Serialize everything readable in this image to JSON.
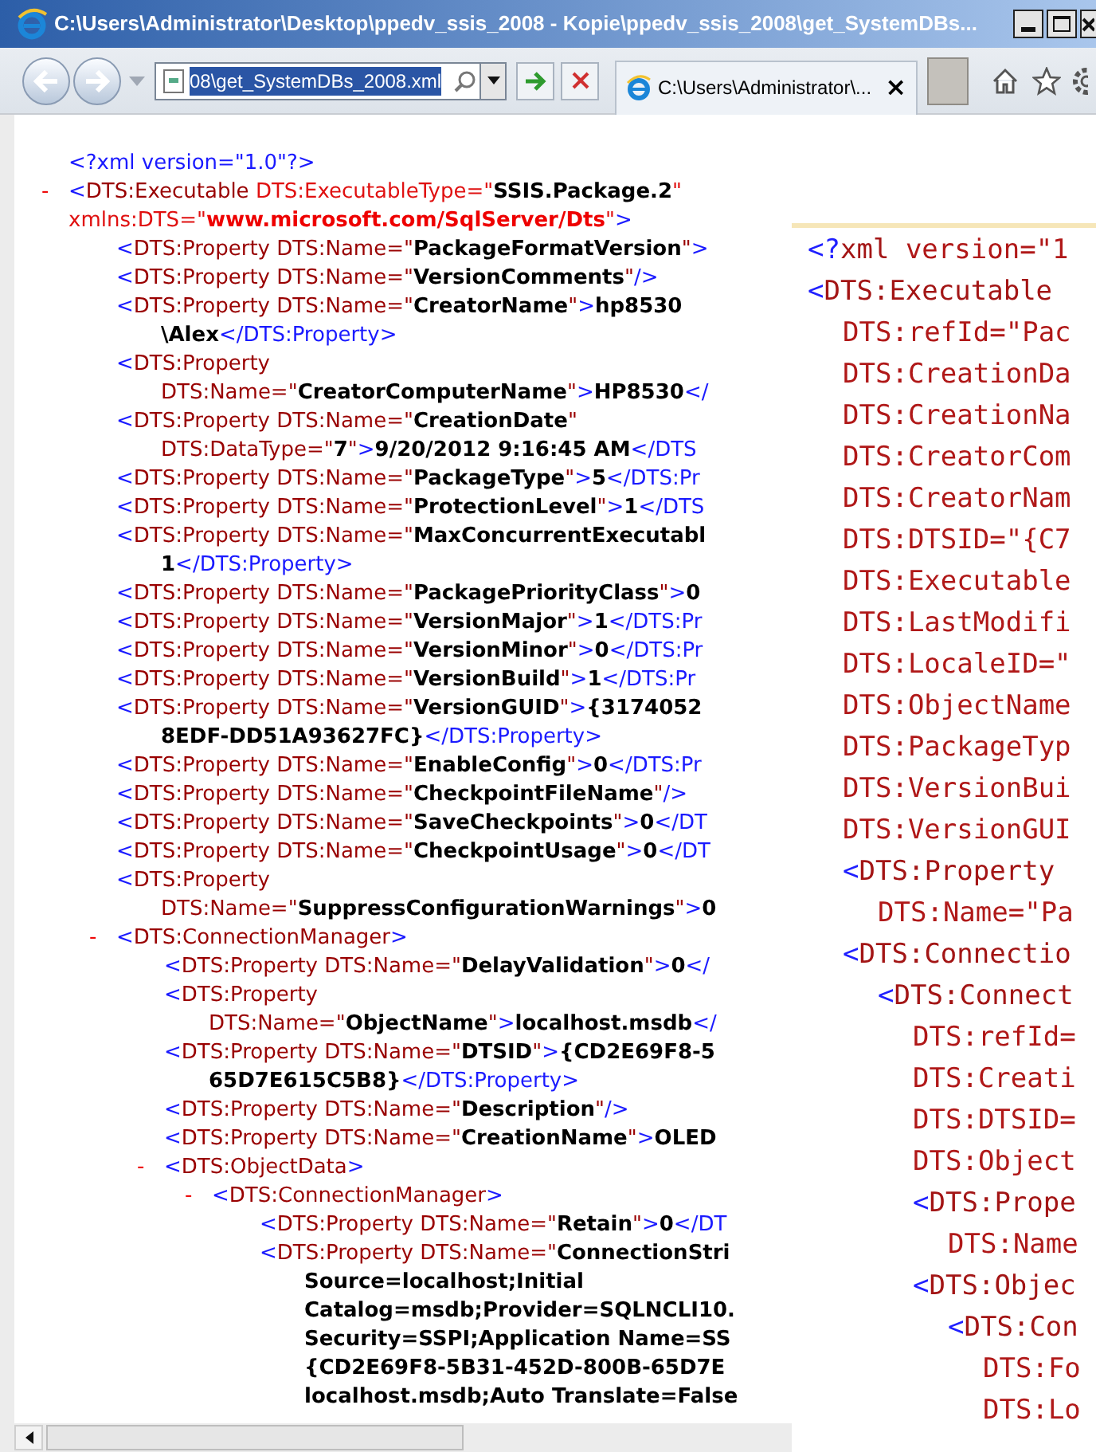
{
  "window": {
    "title": "C:\\Users\\Administrator\\Desktop\\ppedv_ssis_2008 - Kopie\\ppedv_ssis_2008\\get_SystemDBs..."
  },
  "toolbar": {
    "address": {
      "value": "08\\get_SystemDBs_2008.xml",
      "selected": true
    },
    "tab": {
      "title": "C:\\Users\\Administrator\\...",
      "close": "×"
    }
  },
  "xml_view": {
    "nodes": [
      {
        "lines": [
          [
            {
              "kind": "mark",
              "text": "<?xml version=\"1.0\"?>"
            }
          ]
        ]
      },
      {
        "toggle": "-",
        "expanded": true,
        "lines": [
          [
            {
              "kind": "mark",
              "text": "<"
            },
            {
              "kind": "tag",
              "text": "DTS:Executable"
            },
            {
              "kind": "attr",
              "text": " DTS:ExecutableType=\""
            },
            {
              "kind": "val",
              "text": "SSIS.Package.2"
            },
            {
              "kind": "attr",
              "text": "\""
            }
          ],
          [
            {
              "kind": "attr",
              "text": "xmlns:DTS=\""
            },
            {
              "kind": "ns",
              "text": "www.microsoft.com/SqlServer/Dts"
            },
            {
              "kind": "attr",
              "text": "\""
            },
            {
              "kind": "mark",
              "text": ">"
            }
          ]
        ],
        "children": [
          {
            "lines": [
              [
                {
                  "kind": "mark",
                  "text": "<"
                },
                {
                  "kind": "tag",
                  "text": "DTS:Property DTS:Name=\""
                },
                {
                  "kind": "val",
                  "text": "PackageFormatVersion"
                },
                {
                  "kind": "tag",
                  "text": "\""
                },
                {
                  "kind": "mark",
                  "text": ">"
                }
              ]
            ]
          },
          {
            "lines": [
              [
                {
                  "kind": "mark",
                  "text": "<"
                },
                {
                  "kind": "tag",
                  "text": "DTS:Property DTS:Name=\""
                },
                {
                  "kind": "val",
                  "text": "VersionComments"
                },
                {
                  "kind": "tag",
                  "text": "\""
                },
                {
                  "kind": "mark",
                  "text": "/>"
                }
              ]
            ]
          },
          {
            "lines": [
              [
                {
                  "kind": "mark",
                  "text": "<"
                },
                {
                  "kind": "tag",
                  "text": "DTS:Property DTS:Name=\""
                },
                {
                  "kind": "val",
                  "text": "CreatorName"
                },
                {
                  "kind": "tag",
                  "text": "\""
                },
                {
                  "kind": "mark",
                  "text": ">"
                },
                {
                  "kind": "val",
                  "text": "hp8530"
                }
              ],
              [
                {
                  "kind": "val",
                  "text": "\\Alex"
                },
                {
                  "kind": "mark",
                  "text": "</DTS:Property>"
                }
              ]
            ]
          },
          {
            "lines": [
              [
                {
                  "kind": "mark",
                  "text": "<"
                },
                {
                  "kind": "tag",
                  "text": "DTS:Property"
                }
              ],
              [
                {
                  "kind": "tag",
                  "text": "DTS:Name=\""
                },
                {
                  "kind": "val",
                  "text": "CreatorComputerName"
                },
                {
                  "kind": "tag",
                  "text": "\""
                },
                {
                  "kind": "mark",
                  "text": ">"
                },
                {
                  "kind": "val",
                  "text": "HP8530"
                },
                {
                  "kind": "mark",
                  "text": "</"
                }
              ]
            ]
          },
          {
            "lines": [
              [
                {
                  "kind": "mark",
                  "text": "<"
                },
                {
                  "kind": "tag",
                  "text": "DTS:Property DTS:Name=\""
                },
                {
                  "kind": "val",
                  "text": "CreationDate"
                },
                {
                  "kind": "tag",
                  "text": "\""
                }
              ],
              [
                {
                  "kind": "tag",
                  "text": "DTS:DataType=\""
                },
                {
                  "kind": "val",
                  "text": "7"
                },
                {
                  "kind": "tag",
                  "text": "\""
                },
                {
                  "kind": "mark",
                  "text": ">"
                },
                {
                  "kind": "val",
                  "text": "9/20/2012 9:16:45 AM"
                },
                {
                  "kind": "mark",
                  "text": "</DTS"
                }
              ]
            ]
          },
          {
            "lines": [
              [
                {
                  "kind": "mark",
                  "text": "<"
                },
                {
                  "kind": "tag",
                  "text": "DTS:Property DTS:Name=\""
                },
                {
                  "kind": "val",
                  "text": "PackageType"
                },
                {
                  "kind": "tag",
                  "text": "\""
                },
                {
                  "kind": "mark",
                  "text": ">"
                },
                {
                  "kind": "val",
                  "text": "5"
                },
                {
                  "kind": "mark",
                  "text": "</DTS:Pr"
                }
              ]
            ]
          },
          {
            "lines": [
              [
                {
                  "kind": "mark",
                  "text": "<"
                },
                {
                  "kind": "tag",
                  "text": "DTS:Property DTS:Name=\""
                },
                {
                  "kind": "val",
                  "text": "ProtectionLevel"
                },
                {
                  "kind": "tag",
                  "text": "\""
                },
                {
                  "kind": "mark",
                  "text": ">"
                },
                {
                  "kind": "val",
                  "text": "1"
                },
                {
                  "kind": "mark",
                  "text": "</DTS"
                }
              ]
            ]
          },
          {
            "lines": [
              [
                {
                  "kind": "mark",
                  "text": "<"
                },
                {
                  "kind": "tag",
                  "text": "DTS:Property DTS:Name=\""
                },
                {
                  "kind": "val",
                  "text": "MaxConcurrentExecutabl"
                }
              ],
              [
                {
                  "kind": "val",
                  "text": "1"
                },
                {
                  "kind": "mark",
                  "text": "</DTS:Property>"
                }
              ]
            ]
          },
          {
            "lines": [
              [
                {
                  "kind": "mark",
                  "text": "<"
                },
                {
                  "kind": "tag",
                  "text": "DTS:Property DTS:Name=\""
                },
                {
                  "kind": "val",
                  "text": "PackagePriorityClass"
                },
                {
                  "kind": "tag",
                  "text": "\""
                },
                {
                  "kind": "mark",
                  "text": ">"
                },
                {
                  "kind": "val",
                  "text": "0"
                }
              ]
            ]
          },
          {
            "lines": [
              [
                {
                  "kind": "mark",
                  "text": "<"
                },
                {
                  "kind": "tag",
                  "text": "DTS:Property DTS:Name=\""
                },
                {
                  "kind": "val",
                  "text": "VersionMajor"
                },
                {
                  "kind": "tag",
                  "text": "\""
                },
                {
                  "kind": "mark",
                  "text": ">"
                },
                {
                  "kind": "val",
                  "text": "1"
                },
                {
                  "kind": "mark",
                  "text": "</DTS:Pr"
                }
              ]
            ]
          },
          {
            "lines": [
              [
                {
                  "kind": "mark",
                  "text": "<"
                },
                {
                  "kind": "tag",
                  "text": "DTS:Property DTS:Name=\""
                },
                {
                  "kind": "val",
                  "text": "VersionMinor"
                },
                {
                  "kind": "tag",
                  "text": "\""
                },
                {
                  "kind": "mark",
                  "text": ">"
                },
                {
                  "kind": "val",
                  "text": "0"
                },
                {
                  "kind": "mark",
                  "text": "</DTS:Pr"
                }
              ]
            ]
          },
          {
            "lines": [
              [
                {
                  "kind": "mark",
                  "text": "<"
                },
                {
                  "kind": "tag",
                  "text": "DTS:Property DTS:Name=\""
                },
                {
                  "kind": "val",
                  "text": "VersionBuild"
                },
                {
                  "kind": "tag",
                  "text": "\""
                },
                {
                  "kind": "mark",
                  "text": ">"
                },
                {
                  "kind": "val",
                  "text": "1"
                },
                {
                  "kind": "mark",
                  "text": "</DTS:Pr"
                }
              ]
            ]
          },
          {
            "lines": [
              [
                {
                  "kind": "mark",
                  "text": "<"
                },
                {
                  "kind": "tag",
                  "text": "DTS:Property DTS:Name=\""
                },
                {
                  "kind": "val",
                  "text": "VersionGUID"
                },
                {
                  "kind": "tag",
                  "text": "\""
                },
                {
                  "kind": "mark",
                  "text": ">"
                },
                {
                  "kind": "val",
                  "text": "{3174052"
                }
              ],
              [
                {
                  "kind": "val",
                  "text": "8EDF-DD51A93627FC}"
                },
                {
                  "kind": "mark",
                  "text": "</DTS:Property>"
                }
              ]
            ]
          },
          {
            "lines": [
              [
                {
                  "kind": "mark",
                  "text": "<"
                },
                {
                  "kind": "tag",
                  "text": "DTS:Property DTS:Name=\""
                },
                {
                  "kind": "val",
                  "text": "EnableConfig"
                },
                {
                  "kind": "tag",
                  "text": "\""
                },
                {
                  "kind": "mark",
                  "text": ">"
                },
                {
                  "kind": "val",
                  "text": "0"
                },
                {
                  "kind": "mark",
                  "text": "</DTS:Pr"
                }
              ]
            ]
          },
          {
            "lines": [
              [
                {
                  "kind": "mark",
                  "text": "<"
                },
                {
                  "kind": "tag",
                  "text": "DTS:Property DTS:Name=\""
                },
                {
                  "kind": "val",
                  "text": "CheckpointFileName"
                },
                {
                  "kind": "tag",
                  "text": "\""
                },
                {
                  "kind": "mark",
                  "text": "/>"
                }
              ]
            ]
          },
          {
            "lines": [
              [
                {
                  "kind": "mark",
                  "text": "<"
                },
                {
                  "kind": "tag",
                  "text": "DTS:Property DTS:Name=\""
                },
                {
                  "kind": "val",
                  "text": "SaveCheckpoints"
                },
                {
                  "kind": "tag",
                  "text": "\""
                },
                {
                  "kind": "mark",
                  "text": ">"
                },
                {
                  "kind": "val",
                  "text": "0"
                },
                {
                  "kind": "mark",
                  "text": "</DT"
                }
              ]
            ]
          },
          {
            "lines": [
              [
                {
                  "kind": "mark",
                  "text": "<"
                },
                {
                  "kind": "tag",
                  "text": "DTS:Property DTS:Name=\""
                },
                {
                  "kind": "val",
                  "text": "CheckpointUsage"
                },
                {
                  "kind": "tag",
                  "text": "\""
                },
                {
                  "kind": "mark",
                  "text": ">"
                },
                {
                  "kind": "val",
                  "text": "0"
                },
                {
                  "kind": "mark",
                  "text": "</DT"
                }
              ]
            ]
          },
          {
            "lines": [
              [
                {
                  "kind": "mark",
                  "text": "<"
                },
                {
                  "kind": "tag",
                  "text": "DTS:Property"
                }
              ],
              [
                {
                  "kind": "tag",
                  "text": "DTS:Name=\""
                },
                {
                  "kind": "val",
                  "text": "SuppressConfigurationWarnings"
                },
                {
                  "kind": "tag",
                  "text": "\""
                },
                {
                  "kind": "mark",
                  "text": ">"
                },
                {
                  "kind": "val",
                  "text": "0"
                }
              ]
            ]
          },
          {
            "toggle": "-",
            "expanded": true,
            "lines": [
              [
                {
                  "kind": "mark",
                  "text": "<"
                },
                {
                  "kind": "tag",
                  "text": "DTS:ConnectionManager"
                },
                {
                  "kind": "mark",
                  "text": ">"
                }
              ]
            ],
            "children": [
              {
                "lines": [
                  [
                    {
                      "kind": "mark",
                      "text": "<"
                    },
                    {
                      "kind": "tag",
                      "text": "DTS:Property DTS:Name=\""
                    },
                    {
                      "kind": "val",
                      "text": "DelayValidation"
                    },
                    {
                      "kind": "tag",
                      "text": "\""
                    },
                    {
                      "kind": "mark",
                      "text": ">"
                    },
                    {
                      "kind": "val",
                      "text": "0"
                    },
                    {
                      "kind": "mark",
                      "text": "</"
                    }
                  ]
                ]
              },
              {
                "lines": [
                  [
                    {
                      "kind": "mark",
                      "text": "<"
                    },
                    {
                      "kind": "tag",
                      "text": "DTS:Property"
                    }
                  ],
                  [
                    {
                      "kind": "tag",
                      "text": "DTS:Name=\""
                    },
                    {
                      "kind": "val",
                      "text": "ObjectName"
                    },
                    {
                      "kind": "tag",
                      "text": "\""
                    },
                    {
                      "kind": "mark",
                      "text": ">"
                    },
                    {
                      "kind": "val",
                      "text": "localhost.msdb"
                    },
                    {
                      "kind": "mark",
                      "text": "</"
                    }
                  ]
                ]
              },
              {
                "lines": [
                  [
                    {
                      "kind": "mark",
                      "text": "<"
                    },
                    {
                      "kind": "tag",
                      "text": "DTS:Property DTS:Name=\""
                    },
                    {
                      "kind": "val",
                      "text": "DTSID"
                    },
                    {
                      "kind": "tag",
                      "text": "\""
                    },
                    {
                      "kind": "mark",
                      "text": ">"
                    },
                    {
                      "kind": "val",
                      "text": "{CD2E69F8-5"
                    }
                  ],
                  [
                    {
                      "kind": "val",
                      "text": "65D7E615C5B8}"
                    },
                    {
                      "kind": "mark",
                      "text": "</DTS:Property>"
                    }
                  ]
                ]
              },
              {
                "lines": [
                  [
                    {
                      "kind": "mark",
                      "text": "<"
                    },
                    {
                      "kind": "tag",
                      "text": "DTS:Property DTS:Name=\""
                    },
                    {
                      "kind": "val",
                      "text": "Description"
                    },
                    {
                      "kind": "tag",
                      "text": "\""
                    },
                    {
                      "kind": "mark",
                      "text": "/>"
                    }
                  ]
                ]
              },
              {
                "lines": [
                  [
                    {
                      "kind": "mark",
                      "text": "<"
                    },
                    {
                      "kind": "tag",
                      "text": "DTS:Property DTS:Name=\""
                    },
                    {
                      "kind": "val",
                      "text": "CreationName"
                    },
                    {
                      "kind": "tag",
                      "text": "\""
                    },
                    {
                      "kind": "mark",
                      "text": ">"
                    },
                    {
                      "kind": "val",
                      "text": "OLED"
                    }
                  ]
                ]
              },
              {
                "toggle": "-",
                "expanded": true,
                "lines": [
                  [
                    {
                      "kind": "mark",
                      "text": "<"
                    },
                    {
                      "kind": "tag",
                      "text": "DTS:ObjectData"
                    },
                    {
                      "kind": "mark",
                      "text": ">"
                    }
                  ]
                ],
                "children": [
                  {
                    "toggle": "-",
                    "expanded": true,
                    "lines": [
                      [
                        {
                          "kind": "mark",
                          "text": "<"
                        },
                        {
                          "kind": "tag",
                          "text": "DTS:ConnectionManager"
                        },
                        {
                          "kind": "mark",
                          "text": ">"
                        }
                      ]
                    ],
                    "children": [
                      {
                        "lines": [
                          [
                            {
                              "kind": "mark",
                              "text": "<"
                            },
                            {
                              "kind": "tag",
                              "text": "DTS:Property DTS:Name=\""
                            },
                            {
                              "kind": "val",
                              "text": "Retain"
                            },
                            {
                              "kind": "tag",
                              "text": "\""
                            },
                            {
                              "kind": "mark",
                              "text": ">"
                            },
                            {
                              "kind": "val",
                              "text": "0"
                            },
                            {
                              "kind": "mark",
                              "text": "</DT"
                            }
                          ]
                        ]
                      },
                      {
                        "lines": [
                          [
                            {
                              "kind": "mark",
                              "text": "<"
                            },
                            {
                              "kind": "tag",
                              "text": "DTS:Property DTS:Name=\""
                            },
                            {
                              "kind": "val",
                              "text": "ConnectionStri"
                            }
                          ],
                          [
                            {
                              "kind": "val",
                              "text": "Source=localhost;Initial"
                            }
                          ],
                          [
                            {
                              "kind": "val",
                              "text": "Catalog=msdb;Provider=SQLNCLI10."
                            }
                          ],
                          [
                            {
                              "kind": "val",
                              "text": "Security=SSPI;Application Name=SS"
                            }
                          ],
                          [
                            {
                              "kind": "val",
                              "text": "{CD2E69F8-5B31-452D-800B-65D7E"
                            }
                          ],
                          [
                            {
                              "kind": "val",
                              "text": "localhost.msdb;Auto Translate=False"
                            }
                          ]
                        ]
                      }
                    ]
                  }
                ]
              }
            ]
          }
        ]
      }
    ]
  },
  "editor": {
    "nodes": [
      {
        "lines": [
          [
            {
              "kind": "mark",
              "text": "<?"
            },
            {
              "kind": "tag",
              "text": "xml "
            },
            {
              "kind": "attr",
              "text": "version=\"1"
            }
          ]
        ]
      },
      {
        "lines": [
          [
            {
              "kind": "mark",
              "text": "<"
            },
            {
              "kind": "tag",
              "text": "DTS:Executable"
            }
          ],
          [
            {
              "kind": "attr",
              "text": "DTS:refId=\"Pac"
            }
          ],
          [
            {
              "kind": "attr",
              "text": "DTS:CreationDa"
            }
          ],
          [
            {
              "kind": "attr",
              "text": "DTS:CreationNa"
            }
          ],
          [
            {
              "kind": "attr",
              "text": "DTS:CreatorCom"
            }
          ],
          [
            {
              "kind": "attr",
              "text": "DTS:CreatorNam"
            }
          ],
          [
            {
              "kind": "attr",
              "text": "DTS:DTSID=\"{C7"
            }
          ],
          [
            {
              "kind": "attr",
              "text": "DTS:Executable"
            }
          ],
          [
            {
              "kind": "attr",
              "text": "DTS:LastModifi"
            }
          ],
          [
            {
              "kind": "attr",
              "text": "DTS:LocaleID=\""
            }
          ],
          [
            {
              "kind": "attr",
              "text": "DTS:ObjectName"
            }
          ],
          [
            {
              "kind": "attr",
              "text": "DTS:PackageTyp"
            }
          ],
          [
            {
              "kind": "attr",
              "text": "DTS:VersionBui"
            }
          ],
          [
            {
              "kind": "attr",
              "text": "DTS:VersionGUI"
            }
          ]
        ],
        "children": [
          {
            "lines": [
              [
                {
                  "kind": "mark",
                  "text": "<"
                },
                {
                  "kind": "tag",
                  "text": "DTS:Property"
                }
              ],
              [
                {
                  "kind": "attr",
                  "text": "DTS:Name=\"Pa"
                }
              ]
            ]
          },
          {
            "lines": [
              [
                {
                  "kind": "mark",
                  "text": "<"
                },
                {
                  "kind": "tag",
                  "text": "DTS:Connectio"
                }
              ]
            ],
            "children": [
              {
                "lines": [
                  [
                    {
                      "kind": "mark",
                      "text": "<"
                    },
                    {
                      "kind": "tag",
                      "text": "DTS:Connect"
                    }
                  ],
                  [
                    {
                      "kind": "attr",
                      "text": "DTS:refId="
                    }
                  ],
                  [
                    {
                      "kind": "attr",
                      "text": "DTS:Creati"
                    }
                  ],
                  [
                    {
                      "kind": "attr",
                      "text": "DTS:DTSID="
                    }
                  ],
                  [
                    {
                      "kind": "attr",
                      "text": "DTS:Object"
                    }
                  ]
                ],
                "children": [
                  {
                    "lines": [
                      [
                        {
                          "kind": "mark",
                          "text": "<"
                        },
                        {
                          "kind": "tag",
                          "text": "DTS:Prope"
                        }
                      ],
                      [
                        {
                          "kind": "attr",
                          "text": "DTS:Name"
                        }
                      ]
                    ]
                  },
                  {
                    "lines": [
                      [
                        {
                          "kind": "mark",
                          "text": "<"
                        },
                        {
                          "kind": "tag",
                          "text": "DTS:Objec"
                        }
                      ]
                    ],
                    "children": [
                      {
                        "lines": [
                          [
                            {
                              "kind": "mark",
                              "text": "<"
                            },
                            {
                              "kind": "tag",
                              "text": "DTS:Con"
                            }
                          ],
                          [
                            {
                              "kind": "attr",
                              "text": "DTS:Fo"
                            }
                          ],
                          [
                            {
                              "kind": "attr",
                              "text": "DTS:Lo"
                            }
                          ]
                        ]
                      }
                    ]
                  }
                ]
              }
            ]
          }
        ]
      }
    ]
  }
}
